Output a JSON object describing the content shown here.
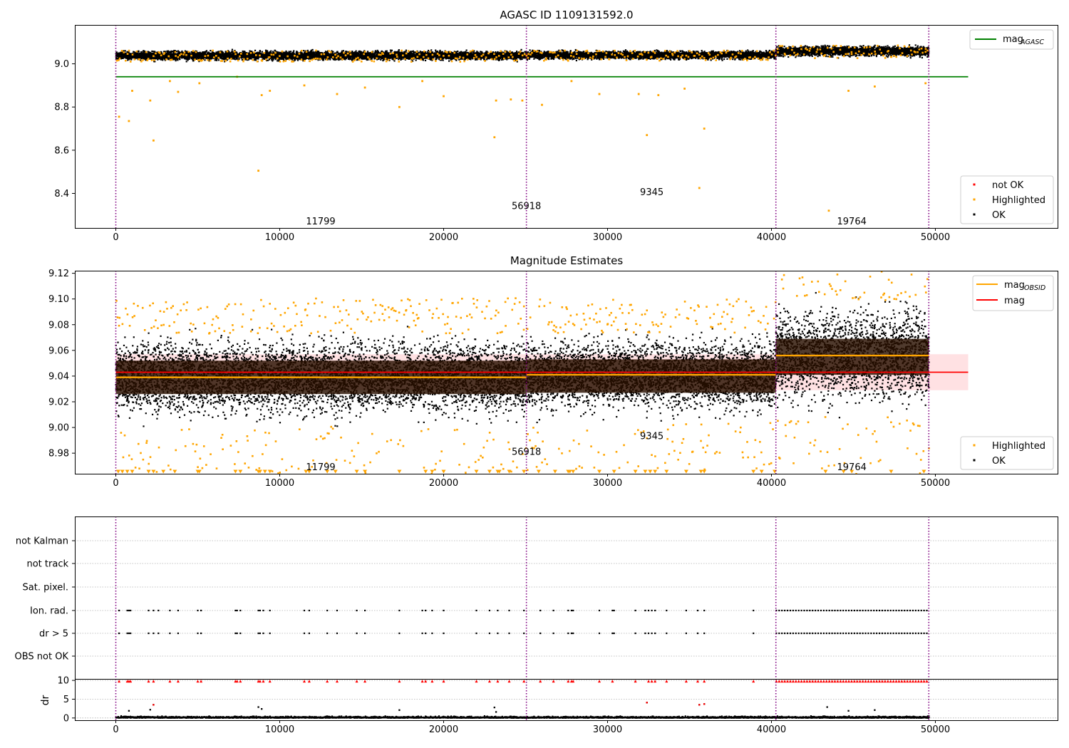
{
  "figure": {
    "panel1_title": "AGASC ID 1109131592.0",
    "panel2_title": "Magnitude Estimates"
  },
  "colors": {
    "ok": "#000000",
    "highlighted": "#ffa500",
    "not_ok": "#ff0000",
    "mag_agasc": "#008000",
    "mag_obsid": "#ffa500",
    "mag": "#ff0000",
    "mag_band": "#ffc8cc",
    "obsid_band": "#2a1000",
    "separator": "#800080",
    "grid": "#b0b0b0"
  },
  "chart_data": [
    {
      "id": "agasc",
      "type": "scatter",
      "title": "AGASC ID 1109131592.0",
      "xlim": [
        -2500,
        57500
      ],
      "ylim": [
        8.24,
        9.18
      ],
      "xticks": [
        0,
        10000,
        20000,
        30000,
        40000,
        50000
      ],
      "yticks": [
        8.4,
        8.6,
        8.8,
        9.0
      ],
      "ytick_labels": [
        "8.4",
        "8.6",
        "8.8",
        "9.0"
      ],
      "legend_top": {
        "position": "upper right",
        "entries": [
          {
            "label": "mag",
            "sub": "AGASC",
            "color": "#008000"
          }
        ]
      },
      "legend_bottom": {
        "position": "lower right",
        "entries": [
          {
            "label": "not OK",
            "color": "#ff0000"
          },
          {
            "label": "Highlighted",
            "color": "#ffa500"
          },
          {
            "label": "OK",
            "color": "#000000"
          }
        ]
      },
      "separators": [
        0,
        25050,
        40270,
        49600
      ],
      "mag_agasc_line": {
        "y": 8.94,
        "x": [
          0,
          52000
        ]
      },
      "obsid_segments": [
        {
          "x": [
            0,
            25050
          ],
          "center": 9.038,
          "spread": 0.022
        },
        {
          "x": [
            25050,
            40270
          ],
          "center": 9.04,
          "spread": 0.02
        },
        {
          "x": [
            40270,
            49600
          ],
          "center": 9.058,
          "spread": 0.025
        }
      ],
      "obsid_labels": [
        {
          "text": "11799",
          "x": 12500,
          "y": 8.27
        },
        {
          "text": "56918",
          "x": 25050,
          "y": 8.34
        },
        {
          "text": "9345",
          "x": 32700,
          "y": 8.405
        },
        {
          "text": "19764",
          "x": 44900,
          "y": 8.27
        }
      ],
      "highlighted_points": [
        [
          200,
          8.755
        ],
        [
          800,
          8.735
        ],
        [
          1000,
          8.875
        ],
        [
          2100,
          8.83
        ],
        [
          2300,
          8.645
        ],
        [
          3300,
          8.92
        ],
        [
          3800,
          8.87
        ],
        [
          5100,
          8.91
        ],
        [
          7400,
          8.94
        ],
        [
          8700,
          8.505
        ],
        [
          8900,
          8.855
        ],
        [
          9400,
          8.875
        ],
        [
          11500,
          8.9
        ],
        [
          13500,
          8.86
        ],
        [
          15200,
          8.89
        ],
        [
          17300,
          8.8
        ],
        [
          18700,
          8.92
        ],
        [
          20000,
          8.85
        ],
        [
          23100,
          8.66
        ],
        [
          23200,
          8.83
        ],
        [
          24100,
          8.835
        ],
        [
          24800,
          8.83
        ],
        [
          26000,
          8.81
        ],
        [
          27800,
          8.92
        ],
        [
          29500,
          8.86
        ],
        [
          31900,
          8.86
        ],
        [
          32400,
          8.67
        ],
        [
          33100,
          8.855
        ],
        [
          34700,
          8.885
        ],
        [
          35600,
          8.425
        ],
        [
          35900,
          8.7
        ],
        [
          43500,
          8.32
        ],
        [
          44700,
          8.875
        ],
        [
          46300,
          8.895
        ],
        [
          49400,
          8.91
        ]
      ]
    },
    {
      "id": "estimates",
      "type": "scatter",
      "title": "Magnitude Estimates",
      "xlim": [
        -2500,
        57500
      ],
      "ylim": [
        8.964,
        9.122
      ],
      "xticks": [
        0,
        10000,
        20000,
        30000,
        40000,
        50000
      ],
      "yticks": [
        8.98,
        9.0,
        9.02,
        9.04,
        9.06,
        9.08,
        9.1,
        9.12
      ],
      "ytick_labels": [
        "8.98",
        "9.00",
        "9.02",
        "9.04",
        "9.06",
        "9.08",
        "9.10",
        "9.12"
      ],
      "legend_top": {
        "position": "upper right",
        "entries": [
          {
            "label": "mag",
            "sub": "OBSID",
            "color": "#ffa500"
          },
          {
            "label": "mag",
            "color": "#ff0000"
          }
        ]
      },
      "legend_bottom": {
        "position": "lower right",
        "entries": [
          {
            "label": "Highlighted",
            "color": "#ffa500"
          },
          {
            "label": "OK",
            "color": "#000000"
          }
        ]
      },
      "separators": [
        0,
        25050,
        40270,
        49600
      ],
      "mag_line": {
        "y": 9.043,
        "x": [
          0,
          52000
        ],
        "band": [
          9.029,
          9.057
        ]
      },
      "obsid_segments": [
        {
          "x": [
            0,
            25050
          ],
          "mag": 9.039,
          "band": [
            9.026,
            9.052
          ],
          "spread": 0.04
        },
        {
          "x": [
            25050,
            40270
          ],
          "mag": 9.041,
          "band": [
            9.027,
            9.053
          ],
          "spread": 0.038
        },
        {
          "x": [
            40270,
            49600
          ],
          "mag": 9.056,
          "band": [
            9.041,
            9.069
          ],
          "spread": 0.05
        }
      ],
      "obsid_labels": [
        {
          "text": "11799",
          "x": 12500,
          "y": 8.969
        },
        {
          "text": "56918",
          "x": 25050,
          "y": 8.981
        },
        {
          "text": "9345",
          "x": 32700,
          "y": 8.993
        },
        {
          "text": "19764",
          "x": 44900,
          "y": 8.969
        }
      ],
      "out_of_range_markers_x": [
        150,
        400,
        700,
        1000,
        2000,
        2300,
        2900,
        3600,
        5000,
        5100,
        7300,
        7600,
        8700,
        8800,
        9100,
        9400,
        11600,
        11800,
        12900,
        13400,
        14700,
        15200,
        17300,
        18900,
        19300,
        20000,
        22000,
        22800,
        23300,
        23400,
        24000,
        24900,
        25800,
        26800,
        27600,
        27700,
        27900,
        29500,
        30400,
        31700,
        32300,
        32600,
        32900,
        33600,
        34800,
        35700,
        35900,
        38900,
        39400,
        40200,
        43300,
        44400,
        44900,
        47300,
        49300
      ]
    },
    {
      "id": "flags",
      "type": "scatter",
      "ytick_labels": [
        "not Kalman",
        "not track",
        "Sat. pixel.",
        "Ion. rad.",
        "dr > 5",
        "OBS not OK"
      ],
      "separators": [
        0,
        25050,
        40270,
        49600
      ],
      "xlim": [
        -2500,
        57500
      ],
      "xticks": [
        0,
        10000,
        20000,
        30000,
        40000,
        50000
      ],
      "ion_rad_x": [
        200,
        700,
        800,
        900,
        2000,
        2300,
        2600,
        3300,
        3800,
        5000,
        5200,
        7300,
        7400,
        7600,
        8700,
        8800,
        9000,
        9400,
        11500,
        11800,
        12900,
        13500,
        14700,
        15200,
        17300,
        18700,
        18900,
        19300,
        20000,
        22000,
        22800,
        23300,
        24000,
        24900,
        25900,
        26700,
        27600,
        27800,
        27900,
        29500,
        30300,
        30400,
        31700,
        32300,
        32500,
        32700,
        32900,
        33600,
        34800,
        35500,
        35900,
        38900
      ],
      "dense_range": [
        40300,
        49500
      ],
      "dense_step": 170
    },
    {
      "id": "dr",
      "type": "scatter",
      "ylabel": "dr",
      "ylim": [
        -0.6,
        10.4
      ],
      "yticks": [
        0,
        5,
        10
      ],
      "ytick_labels": [
        "0",
        "5",
        "10"
      ],
      "xlim": [
        -2500,
        57500
      ],
      "xticks": [
        0,
        10000,
        20000,
        30000,
        40000,
        50000
      ],
      "xtick_labels": [
        "0",
        "10000",
        "20000",
        "30000",
        "40000",
        "50000"
      ],
      "separators": [
        0,
        25050,
        40270,
        49600
      ],
      "clipped_markers_x": [
        200,
        700,
        800,
        900,
        2000,
        2300,
        3300,
        3800,
        5000,
        5200,
        7300,
        7400,
        7600,
        8700,
        8800,
        9000,
        9400,
        11500,
        11800,
        12900,
        13500,
        14700,
        15200,
        17300,
        18700,
        18900,
        19300,
        20000,
        22000,
        22800,
        23300,
        24000,
        24900,
        25900,
        26700,
        27600,
        27800,
        27900,
        29500,
        30300,
        31700,
        32500,
        32700,
        32900,
        33600,
        34800,
        35500,
        35900,
        38900
      ],
      "outlier_points": [
        [
          800,
          1.9
        ],
        [
          2100,
          2.2
        ],
        [
          2300,
          3.5
        ],
        [
          8700,
          2.9
        ],
        [
          8900,
          2.4
        ],
        [
          17300,
          2.1
        ],
        [
          23100,
          2.8
        ],
        [
          23200,
          1.6
        ],
        [
          32400,
          4.1
        ],
        [
          35600,
          3.5
        ],
        [
          35900,
          3.7
        ],
        [
          43400,
          2.9
        ],
        [
          44700,
          1.9
        ],
        [
          46300,
          2.1
        ]
      ],
      "outlier_highlighted": [
        [
          2300,
          3.5
        ],
        [
          32400,
          4.1
        ],
        [
          35600,
          3.5
        ],
        [
          35900,
          3.7
        ]
      ]
    }
  ]
}
